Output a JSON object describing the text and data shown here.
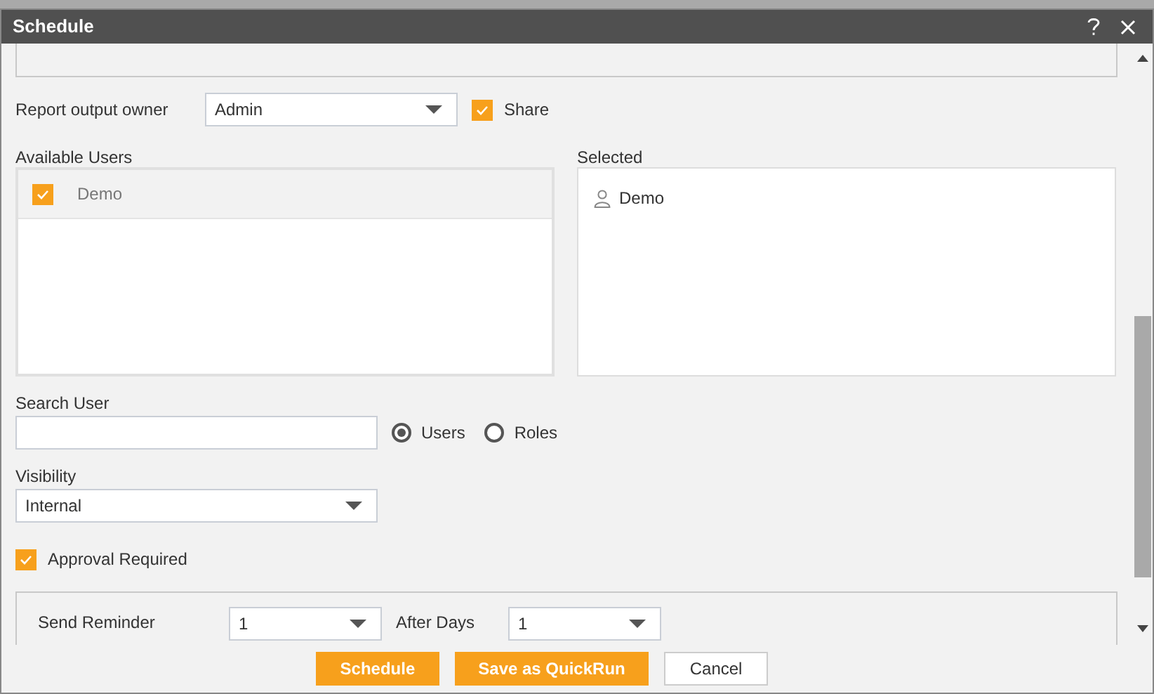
{
  "window": {
    "title": "Schedule"
  },
  "owner": {
    "label": "Report output owner",
    "value": "Admin",
    "share": {
      "label": "Share",
      "checked": true
    }
  },
  "available_users": {
    "label": "Available Users",
    "items": [
      {
        "name": "Demo",
        "checked": true
      }
    ]
  },
  "selected_users": {
    "label": "Selected",
    "items": [
      {
        "name": "Demo"
      }
    ]
  },
  "search": {
    "label": "Search User",
    "options": [
      {
        "label": "Users",
        "selected": true
      },
      {
        "label": "Roles",
        "selected": false
      }
    ]
  },
  "visibility": {
    "label": "Visibility",
    "value": "Internal"
  },
  "approval": {
    "label": "Approval Required",
    "checked": true
  },
  "reminder": {
    "label": "Send Reminder",
    "value": "1",
    "after_label": "After Days",
    "after_value": "1"
  },
  "buttons": [
    {
      "label": "Schedule",
      "kind": "primary"
    },
    {
      "label": "Save as QuickRun",
      "kind": "primary"
    },
    {
      "label": "Cancel",
      "kind": "secondary"
    }
  ]
}
